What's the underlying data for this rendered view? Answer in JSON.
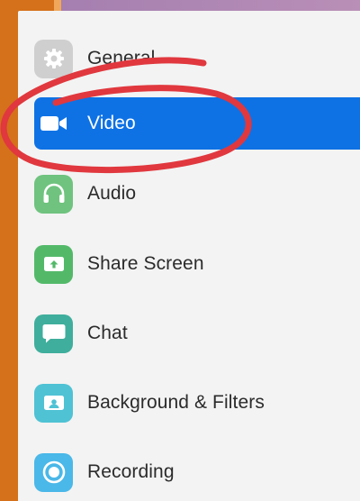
{
  "settings_nav": {
    "items": [
      {
        "label": "General",
        "icon": "gear-icon"
      },
      {
        "label": "Video",
        "icon": "video-camera-icon",
        "selected": true
      },
      {
        "label": "Audio",
        "icon": "headphones-icon"
      },
      {
        "label": "Share Screen",
        "icon": "share-screen-icon"
      },
      {
        "label": "Chat",
        "icon": "chat-bubble-icon"
      },
      {
        "label": "Background & Filters",
        "icon": "background-filters-icon"
      },
      {
        "label": "Recording",
        "icon": "recording-icon"
      }
    ]
  },
  "colors": {
    "selected_bg": "#0e72e5",
    "annotation": "#e0383e",
    "frame": "#d4711a"
  }
}
